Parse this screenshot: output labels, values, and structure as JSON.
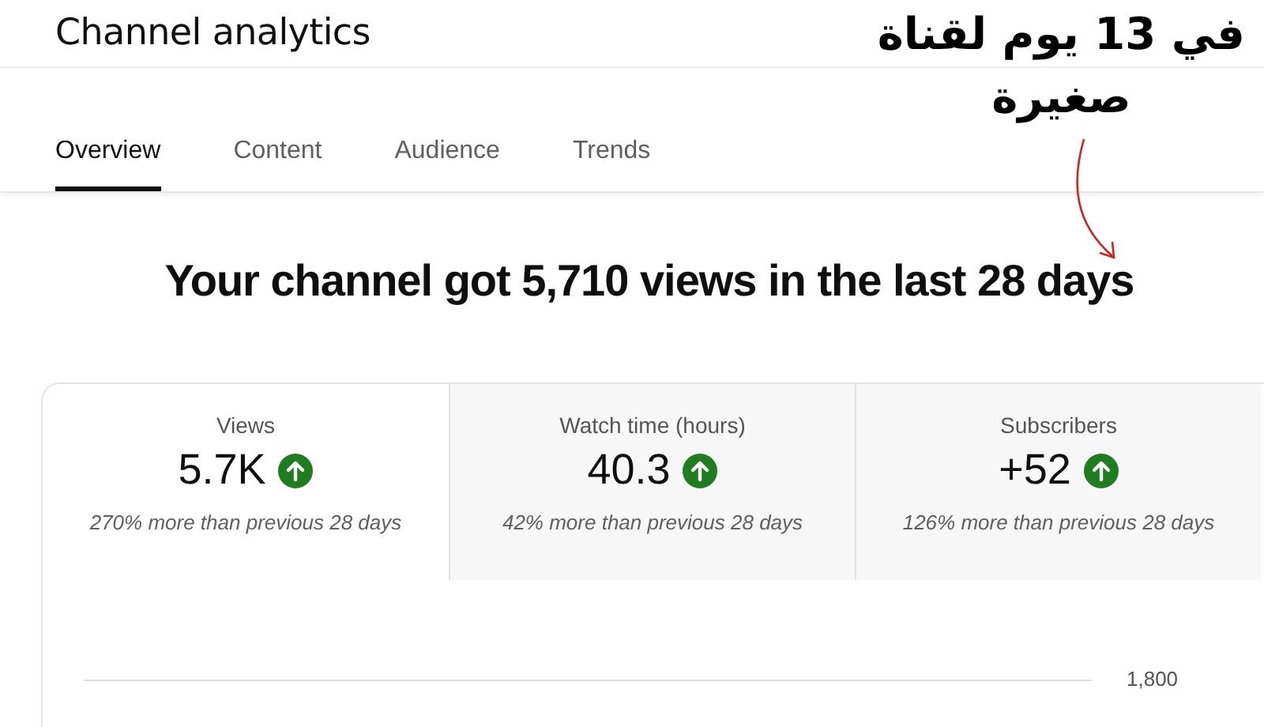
{
  "page_title": "Channel analytics",
  "tabs": [
    {
      "label": "Overview",
      "selected": true
    },
    {
      "label": "Content",
      "selected": false
    },
    {
      "label": "Audience",
      "selected": false
    },
    {
      "label": "Trends",
      "selected": false
    }
  ],
  "headline": "Your channel got 5,710 views in the last 28 days",
  "metrics": [
    {
      "label": "Views",
      "value": "5.7K",
      "comparison": "270% more than previous 28 days",
      "selected": true
    },
    {
      "label": "Watch time (hours)",
      "value": "40.3",
      "comparison": "42% more than previous 28 days",
      "selected": false
    },
    {
      "label": "Subscribers",
      "value": "+52",
      "comparison": "126% more than previous 28 days",
      "selected": false
    }
  ],
  "chart": {
    "y_tick": "1,800"
  },
  "annotation": {
    "lines": [
      "في 13 يوم لقناة",
      "صغيرة"
    ]
  }
}
